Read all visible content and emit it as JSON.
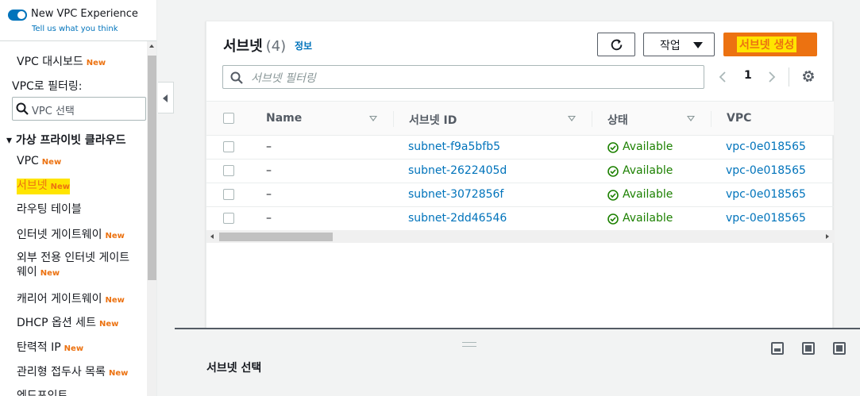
{
  "vpc_experience": {
    "title": "New VPC Experience",
    "link": "Tell us what you think"
  },
  "sidebar": {
    "dashboard": "VPC 대시보드",
    "filter_label": "VPC로 필터링:",
    "filter_placeholder": "VPC 선택",
    "section": "가상 프라이빗 클라우드",
    "new_badge": "New",
    "items": [
      {
        "label": "VPC",
        "new": true
      },
      {
        "label": "서브넷",
        "new": true
      },
      {
        "label": "라우팅 테이블",
        "new": false
      },
      {
        "label": "인터넷 게이트웨이",
        "new": true
      },
      {
        "label": "외부 전용 인터넷 게이트",
        "label2": "웨이",
        "new": true
      },
      {
        "label": "캐리어 게이트웨이",
        "new": true
      },
      {
        "label": "DHCP 옵션 세트",
        "new": true
      },
      {
        "label": "탄력적 IP",
        "new": true
      },
      {
        "label": "관리형 접두사 목록",
        "new": true
      },
      {
        "label": "엔드포인트",
        "new": false
      }
    ]
  },
  "panel": {
    "title": "서브넷",
    "count": "(4)",
    "info": "정보",
    "actions_label": "작업",
    "create_label": "서브넷 생성",
    "search_placeholder": "서브넷 필터링",
    "page": "1"
  },
  "table": {
    "columns": [
      "Name",
      "서브넷 ID",
      "상태",
      "VPC"
    ],
    "rows": [
      {
        "name": "–",
        "subnet_id": "subnet-f9a5bfb5",
        "status": "Available",
        "vpc": "vpc-0e018565"
      },
      {
        "name": "–",
        "subnet_id": "subnet-2622405d",
        "status": "Available",
        "vpc": "vpc-0e018565"
      },
      {
        "name": "–",
        "subnet_id": "subnet-3072856f",
        "status": "Available",
        "vpc": "vpc-0e018565"
      },
      {
        "name": "–",
        "subnet_id": "subnet-2dd46546",
        "status": "Available",
        "vpc": "vpc-0e018565"
      }
    ]
  },
  "split": {
    "title": "서브넷 선택"
  },
  "colors": {
    "accent": "#0073bb",
    "primary_button": "#ec7211",
    "highlight": "#ffe500",
    "success": "#1d8102"
  }
}
